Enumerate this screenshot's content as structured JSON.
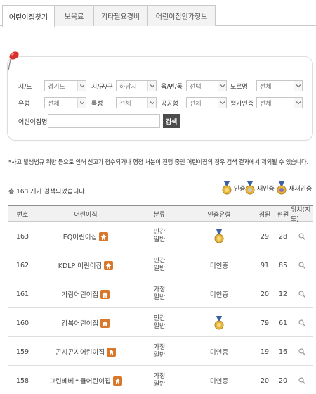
{
  "tabs": [
    {
      "label": "어린이집찾기"
    },
    {
      "label": "보육료"
    },
    {
      "label": "기타필요경비"
    },
    {
      "label": "어린이집인가정보"
    }
  ],
  "search": {
    "sido_label": "시/도",
    "sido_value": "경기도",
    "sigungu_label": "시/군/구",
    "sigungu_value": "하남시",
    "eup_label": "읍/면/동",
    "eup_value": "선택",
    "road_label": "도로명",
    "road_value": "전체",
    "type_label": "유형",
    "type_value": "전체",
    "feature_label": "특성",
    "feature_value": "전체",
    "public_label": "공공형",
    "public_value": "전체",
    "cert_label": "평가인증",
    "cert_value": "전체",
    "name_label": "어린이집명",
    "name_value": "",
    "search_button": "검색"
  },
  "notice": "*사고 발생법규 위반 등으로 인해 신고가 접수되거나 행정 처분이 진행 중인 어린이집의 경우 검색 결과에서 제외될 수 있습니다.",
  "total_text": "총 163 개가 검색되었습니다.",
  "legend": {
    "certified": "인증",
    "recertified": "재인증",
    "re_recertified": "재재인증"
  },
  "table": {
    "headers": {
      "no": "번호",
      "name": "어린이집",
      "type": "분류",
      "cert": "인증유형",
      "capacity": "정원",
      "current": "현원",
      "map": "위치(지도)"
    },
    "rows": [
      {
        "no": "163",
        "name": "EQ어린이집",
        "type1": "민간",
        "type2": "일반",
        "cert": "",
        "capacity": "29",
        "current": "28"
      },
      {
        "no": "162",
        "name": "KDLP 어린이집",
        "type1": "민간",
        "type2": "일반",
        "cert": "미인증",
        "capacity": "91",
        "current": "85"
      },
      {
        "no": "161",
        "name": "가람어린이집",
        "type1": "가정",
        "type2": "일반",
        "cert": "미인증",
        "capacity": "20",
        "current": "12"
      },
      {
        "no": "160",
        "name": "감북어린이집",
        "type1": "민간",
        "type2": "일반",
        "cert": "",
        "capacity": "79",
        "current": "61"
      },
      {
        "no": "159",
        "name": "곤지곤지어린이집",
        "type1": "가정",
        "type2": "일반",
        "cert": "미인증",
        "capacity": "19",
        "current": "16"
      },
      {
        "no": "158",
        "name": "그린베베스쿨어린이집",
        "type1": "가정",
        "type2": "일반",
        "cert": "미인증",
        "capacity": "20",
        "current": "20"
      }
    ]
  },
  "colors": {
    "medal_gold": "#e7b53a",
    "medal_ribbon": "#3a5fa8",
    "home_icon": "#d9772b",
    "search_btn": "#4b4b4b",
    "pin": "#d6332e"
  }
}
